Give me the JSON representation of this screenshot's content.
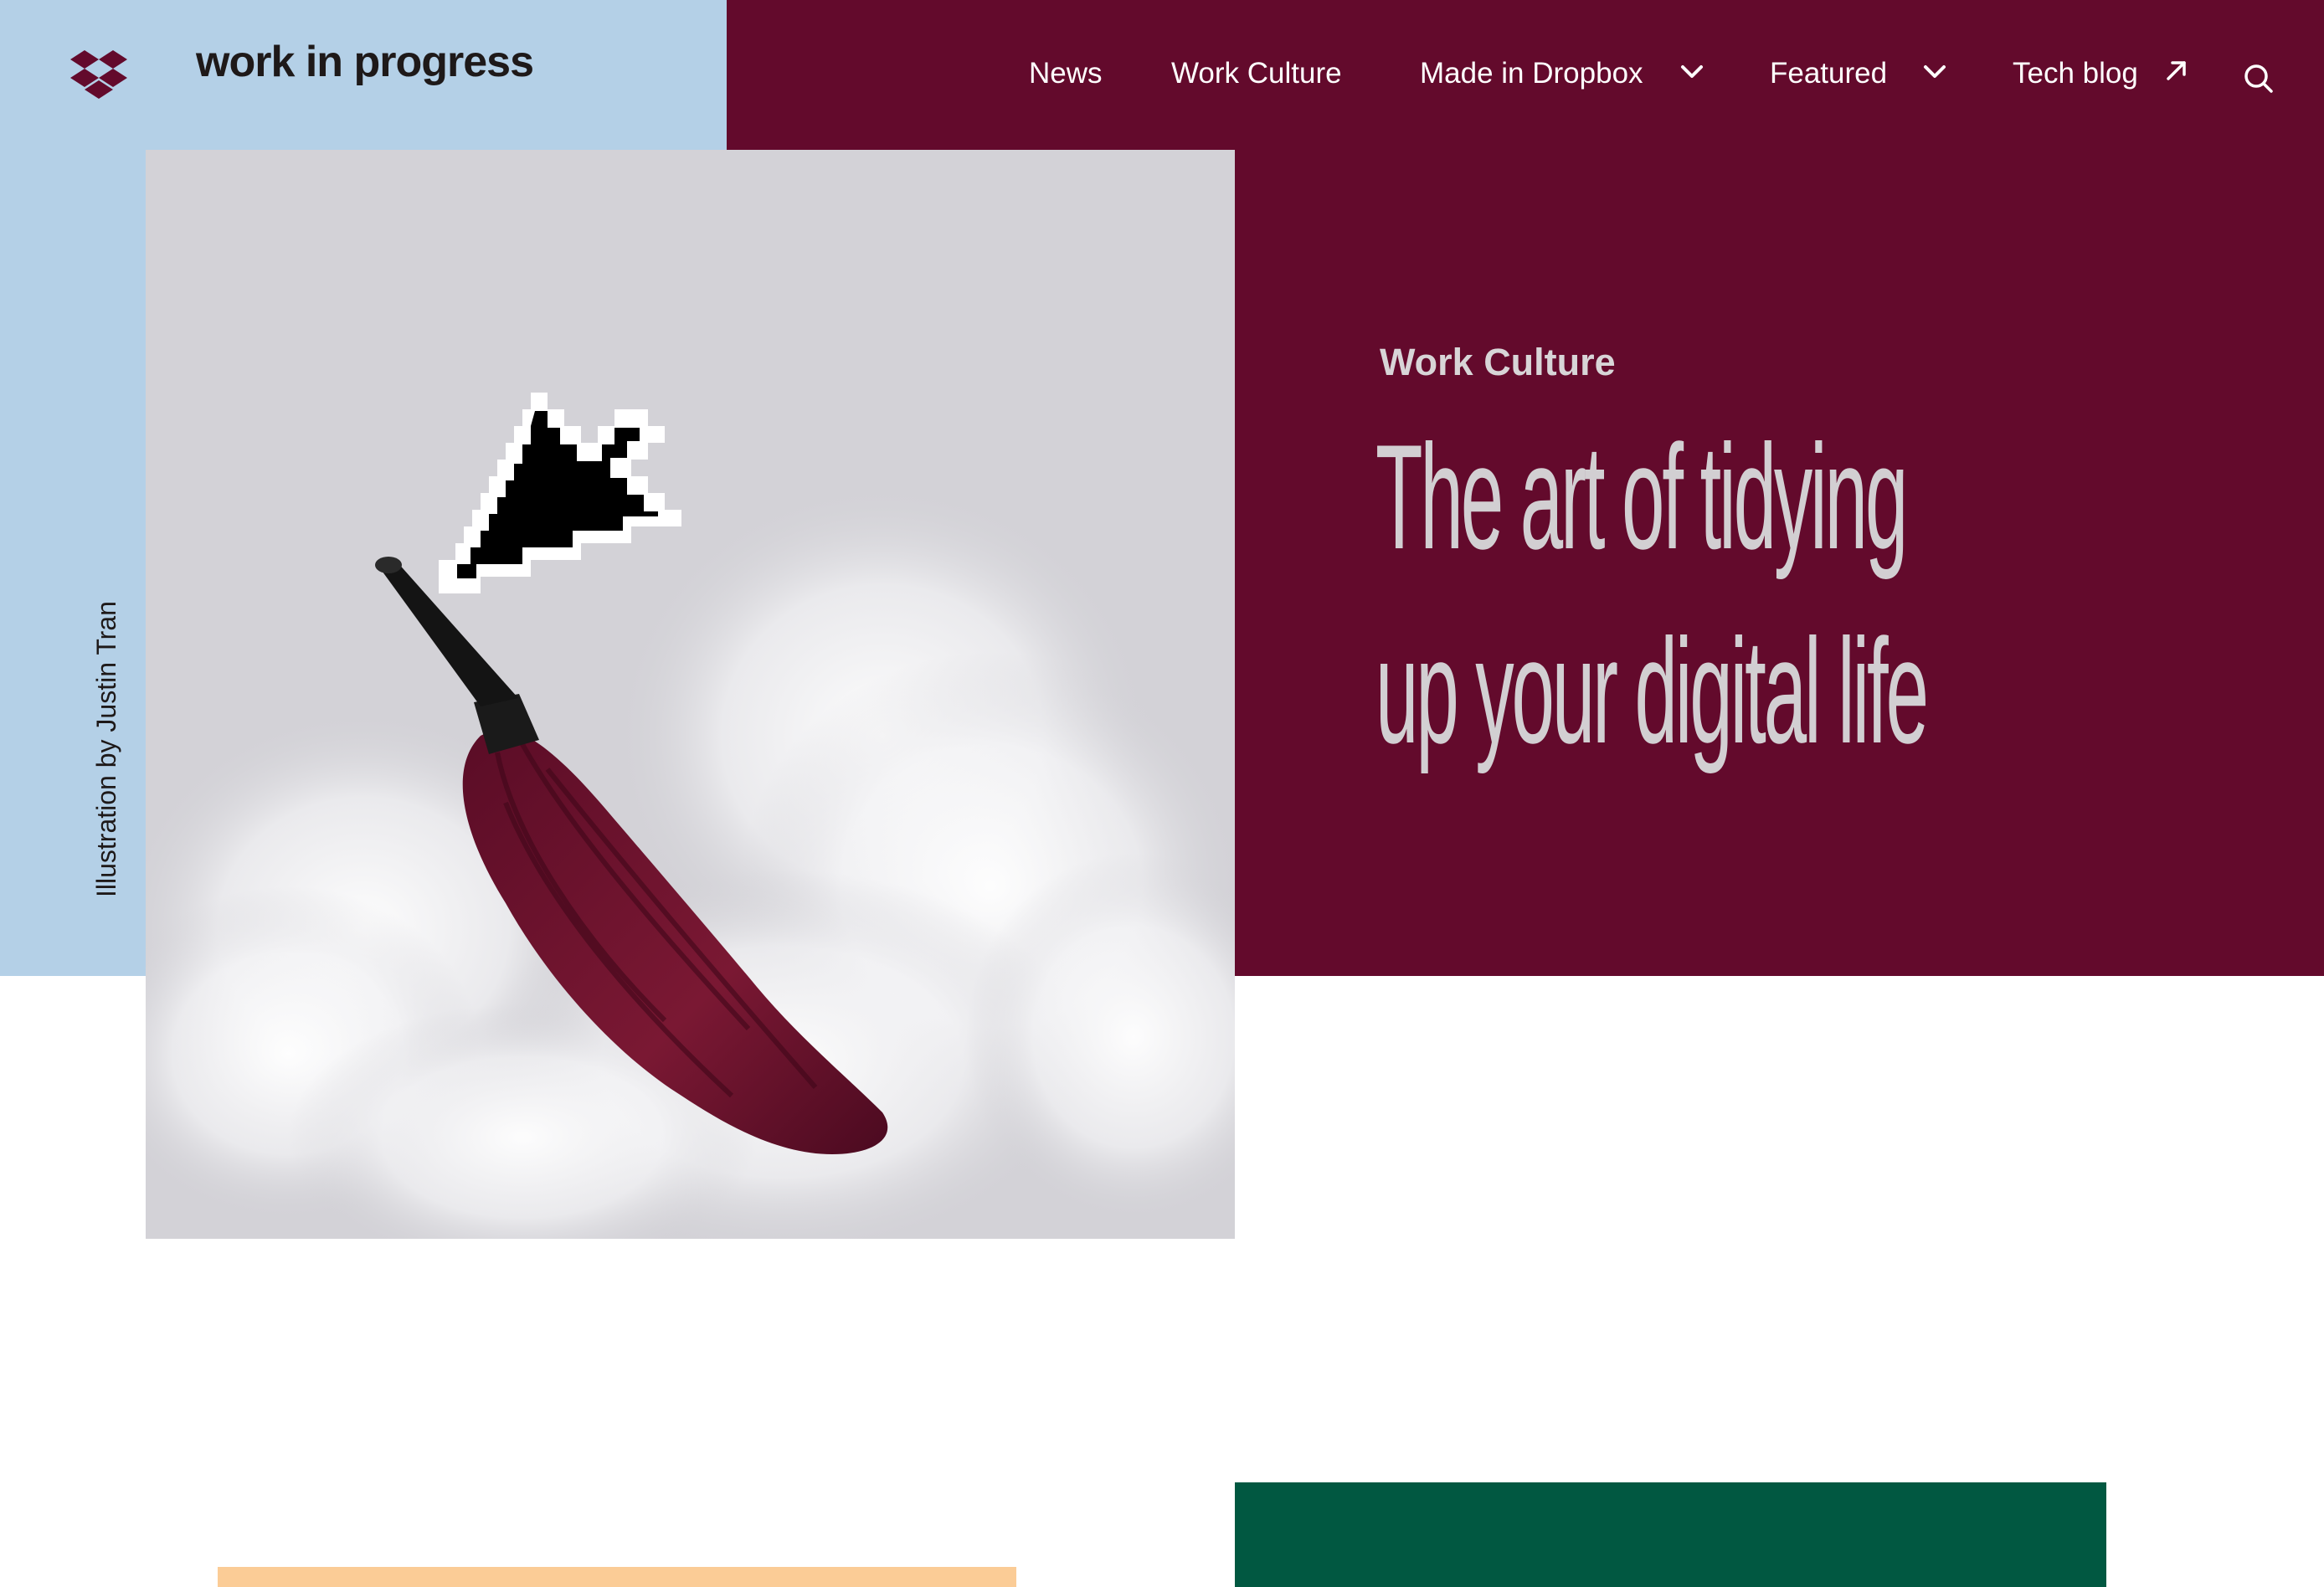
{
  "brand": {
    "logo_icon": "dropbox-logo-icon",
    "title": "work in progress",
    "accent_color": "#630a2c",
    "panel_color": "#b4d0e7"
  },
  "nav": {
    "items": [
      {
        "label": "News",
        "icon": null
      },
      {
        "label": "Work Culture",
        "icon": null
      },
      {
        "label": "Made in Dropbox",
        "icon": "chevron-down-icon"
      },
      {
        "label": "Featured",
        "icon": "chevron-down-icon"
      },
      {
        "label": "Tech blog",
        "icon": "arrow-up-right-icon"
      }
    ],
    "search_icon": "search-icon"
  },
  "hero": {
    "kicker": "Work Culture",
    "headline_line1": "The art of tidying",
    "headline_line2": "up your digital life",
    "image_description_icon": "feather-duster-cursor-illustration",
    "credit": "Illustration by Justin Tran"
  },
  "cards": {
    "peach_color": "#fbcc96",
    "green_color": "#015841"
  }
}
